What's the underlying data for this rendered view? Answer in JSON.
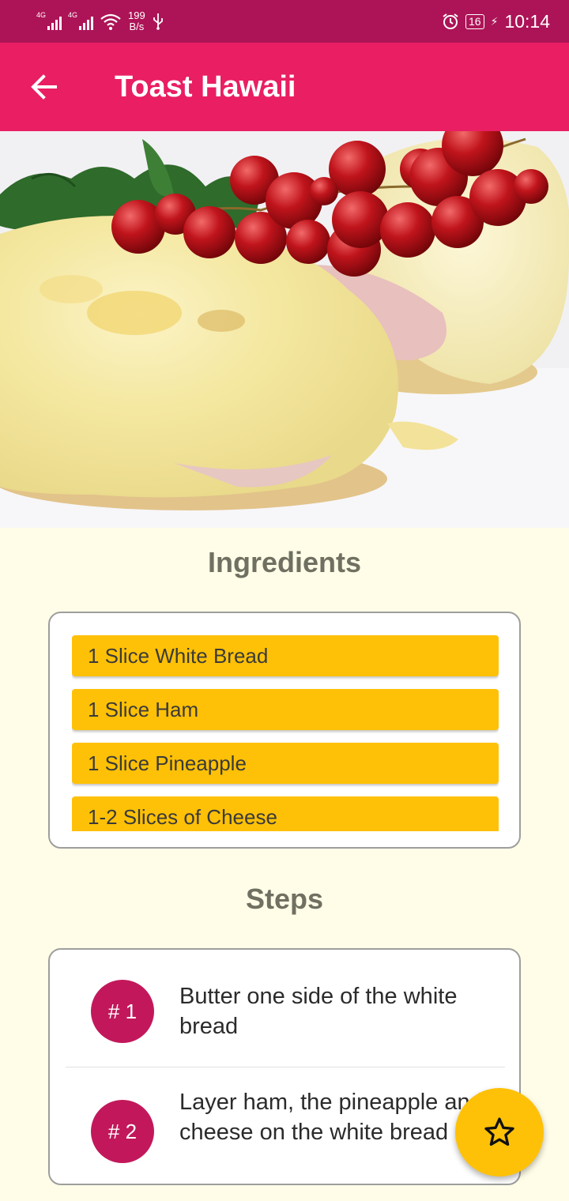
{
  "status_bar": {
    "network_1": "4G",
    "network_2": "4G",
    "speed_value": "199",
    "speed_unit": "B/s",
    "battery": "16",
    "time": "10:14",
    "icons": [
      "signal-icon",
      "wifi-icon",
      "usb-icon",
      "alarm-icon",
      "battery-icon",
      "charging-icon"
    ]
  },
  "app_bar": {
    "back_icon": "arrow-left-icon",
    "title": "Toast Hawaii"
  },
  "ingredients": {
    "heading": "Ingredients",
    "items": [
      "1 Slice White Bread",
      "1 Slice Ham",
      "1 Slice Pineapple",
      "1-2 Slices of Cheese"
    ]
  },
  "steps": {
    "heading": "Steps",
    "items": [
      {
        "number": "# 1",
        "text": "Butter one side of the white bread"
      },
      {
        "number": "# 2",
        "text": "Layer ham, the pineapple and cheese on the white bread"
      }
    ]
  },
  "fab": {
    "icon": "star-outline-icon"
  },
  "colors": {
    "status_bar": "#ad1457",
    "app_bar": "#e91e63",
    "background": "#fffde7",
    "ingredient_chip": "#ffc107",
    "step_badge": "#c2185b",
    "fab": "#ffc107",
    "heading_text": "#707062"
  }
}
